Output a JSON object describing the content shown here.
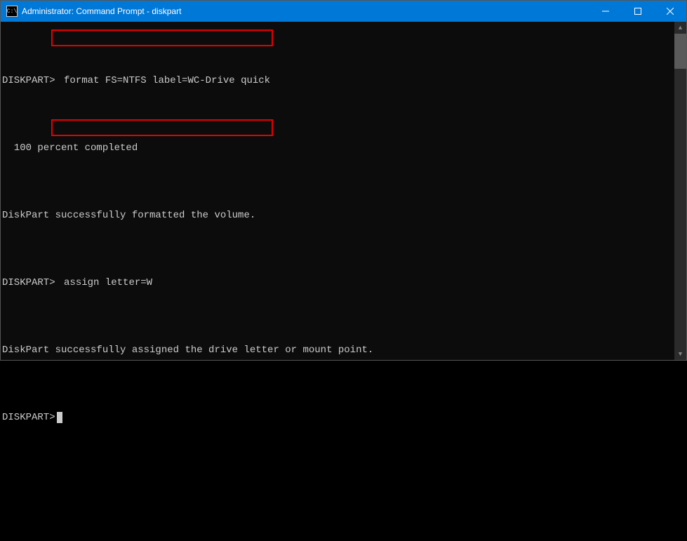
{
  "titlebar": {
    "title": "Administrator: Command Prompt - diskpart"
  },
  "terminal": {
    "prompt": "DISKPART>",
    "lines": [
      {
        "prompt": "DISKPART>",
        "cmd": "format FS=NTFS label=WC-Drive quick"
      },
      {
        "text": "  100 percent completed"
      },
      {
        "text": "DiskPart successfully formatted the volume."
      },
      {
        "prompt": "DISKPART>",
        "cmd": "assign letter=W"
      },
      {
        "text": "DiskPart successfully assigned the drive letter or mount point."
      },
      {
        "prompt": "DISKPART>",
        "cmd": ""
      }
    ]
  }
}
